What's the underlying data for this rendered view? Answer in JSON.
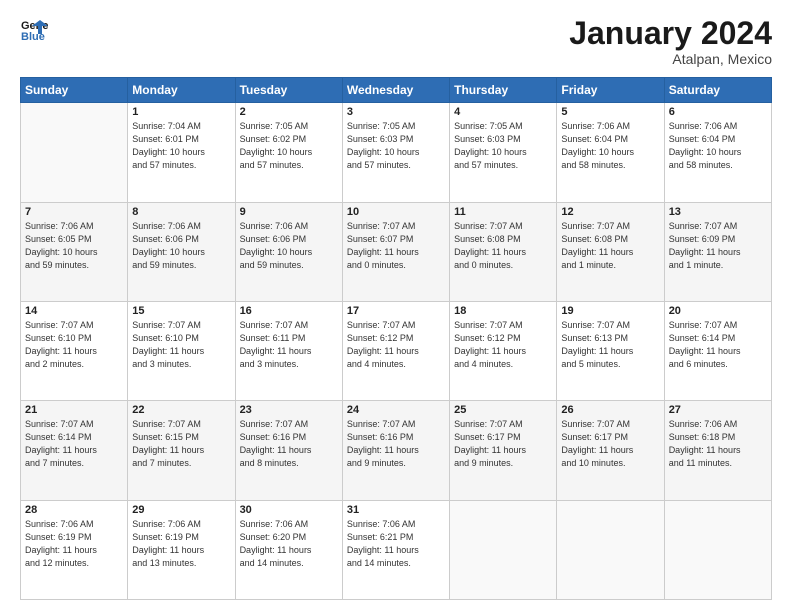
{
  "header": {
    "logo_line1": "General",
    "logo_line2": "Blue",
    "month": "January 2024",
    "location": "Atalpan, Mexico"
  },
  "weekdays": [
    "Sunday",
    "Monday",
    "Tuesday",
    "Wednesday",
    "Thursday",
    "Friday",
    "Saturday"
  ],
  "weeks": [
    [
      {
        "day": "",
        "info": ""
      },
      {
        "day": "1",
        "info": "Sunrise: 7:04 AM\nSunset: 6:01 PM\nDaylight: 10 hours\nand 57 minutes."
      },
      {
        "day": "2",
        "info": "Sunrise: 7:05 AM\nSunset: 6:02 PM\nDaylight: 10 hours\nand 57 minutes."
      },
      {
        "day": "3",
        "info": "Sunrise: 7:05 AM\nSunset: 6:03 PM\nDaylight: 10 hours\nand 57 minutes."
      },
      {
        "day": "4",
        "info": "Sunrise: 7:05 AM\nSunset: 6:03 PM\nDaylight: 10 hours\nand 57 minutes."
      },
      {
        "day": "5",
        "info": "Sunrise: 7:06 AM\nSunset: 6:04 PM\nDaylight: 10 hours\nand 58 minutes."
      },
      {
        "day": "6",
        "info": "Sunrise: 7:06 AM\nSunset: 6:04 PM\nDaylight: 10 hours\nand 58 minutes."
      }
    ],
    [
      {
        "day": "7",
        "info": "Sunrise: 7:06 AM\nSunset: 6:05 PM\nDaylight: 10 hours\nand 59 minutes."
      },
      {
        "day": "8",
        "info": "Sunrise: 7:06 AM\nSunset: 6:06 PM\nDaylight: 10 hours\nand 59 minutes."
      },
      {
        "day": "9",
        "info": "Sunrise: 7:06 AM\nSunset: 6:06 PM\nDaylight: 10 hours\nand 59 minutes."
      },
      {
        "day": "10",
        "info": "Sunrise: 7:07 AM\nSunset: 6:07 PM\nDaylight: 11 hours\nand 0 minutes."
      },
      {
        "day": "11",
        "info": "Sunrise: 7:07 AM\nSunset: 6:08 PM\nDaylight: 11 hours\nand 0 minutes."
      },
      {
        "day": "12",
        "info": "Sunrise: 7:07 AM\nSunset: 6:08 PM\nDaylight: 11 hours\nand 1 minute."
      },
      {
        "day": "13",
        "info": "Sunrise: 7:07 AM\nSunset: 6:09 PM\nDaylight: 11 hours\nand 1 minute."
      }
    ],
    [
      {
        "day": "14",
        "info": "Sunrise: 7:07 AM\nSunset: 6:10 PM\nDaylight: 11 hours\nand 2 minutes."
      },
      {
        "day": "15",
        "info": "Sunrise: 7:07 AM\nSunset: 6:10 PM\nDaylight: 11 hours\nand 3 minutes."
      },
      {
        "day": "16",
        "info": "Sunrise: 7:07 AM\nSunset: 6:11 PM\nDaylight: 11 hours\nand 3 minutes."
      },
      {
        "day": "17",
        "info": "Sunrise: 7:07 AM\nSunset: 6:12 PM\nDaylight: 11 hours\nand 4 minutes."
      },
      {
        "day": "18",
        "info": "Sunrise: 7:07 AM\nSunset: 6:12 PM\nDaylight: 11 hours\nand 4 minutes."
      },
      {
        "day": "19",
        "info": "Sunrise: 7:07 AM\nSunset: 6:13 PM\nDaylight: 11 hours\nand 5 minutes."
      },
      {
        "day": "20",
        "info": "Sunrise: 7:07 AM\nSunset: 6:14 PM\nDaylight: 11 hours\nand 6 minutes."
      }
    ],
    [
      {
        "day": "21",
        "info": "Sunrise: 7:07 AM\nSunset: 6:14 PM\nDaylight: 11 hours\nand 7 minutes."
      },
      {
        "day": "22",
        "info": "Sunrise: 7:07 AM\nSunset: 6:15 PM\nDaylight: 11 hours\nand 7 minutes."
      },
      {
        "day": "23",
        "info": "Sunrise: 7:07 AM\nSunset: 6:16 PM\nDaylight: 11 hours\nand 8 minutes."
      },
      {
        "day": "24",
        "info": "Sunrise: 7:07 AM\nSunset: 6:16 PM\nDaylight: 11 hours\nand 9 minutes."
      },
      {
        "day": "25",
        "info": "Sunrise: 7:07 AM\nSunset: 6:17 PM\nDaylight: 11 hours\nand 9 minutes."
      },
      {
        "day": "26",
        "info": "Sunrise: 7:07 AM\nSunset: 6:17 PM\nDaylight: 11 hours\nand 10 minutes."
      },
      {
        "day": "27",
        "info": "Sunrise: 7:06 AM\nSunset: 6:18 PM\nDaylight: 11 hours\nand 11 minutes."
      }
    ],
    [
      {
        "day": "28",
        "info": "Sunrise: 7:06 AM\nSunset: 6:19 PM\nDaylight: 11 hours\nand 12 minutes."
      },
      {
        "day": "29",
        "info": "Sunrise: 7:06 AM\nSunset: 6:19 PM\nDaylight: 11 hours\nand 13 minutes."
      },
      {
        "day": "30",
        "info": "Sunrise: 7:06 AM\nSunset: 6:20 PM\nDaylight: 11 hours\nand 14 minutes."
      },
      {
        "day": "31",
        "info": "Sunrise: 7:06 AM\nSunset: 6:21 PM\nDaylight: 11 hours\nand 14 minutes."
      },
      {
        "day": "",
        "info": ""
      },
      {
        "day": "",
        "info": ""
      },
      {
        "day": "",
        "info": ""
      }
    ]
  ]
}
